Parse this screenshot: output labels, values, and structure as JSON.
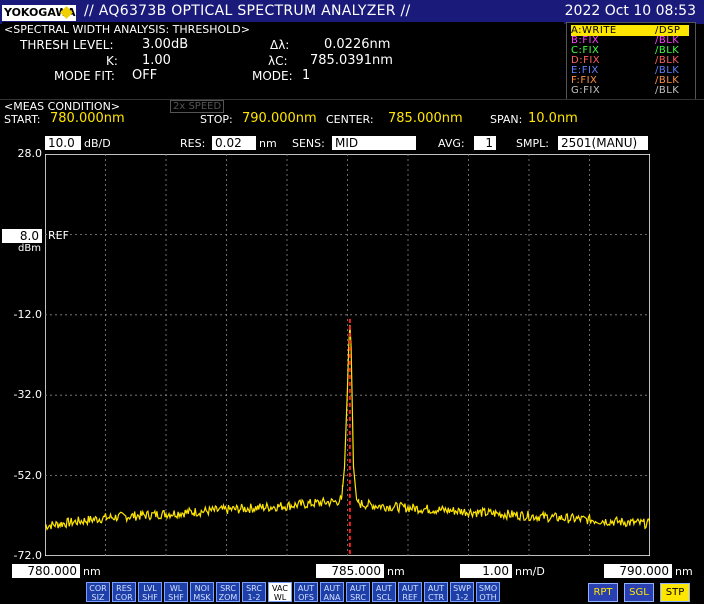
{
  "header": {
    "logo": "YOKOGAWA",
    "title": "// AQ6373B OPTICAL SPECTRUM ANALYZER //",
    "datetime": "2022 Oct 10 08:53"
  },
  "analysis": {
    "heading": "<SPECTRAL WIDTH ANALYSIS: THRESHOLD>",
    "thresh_label": "THRESH LEVEL:",
    "thresh_value": "3.00dB",
    "k_label": "K:",
    "k_value": "1.00",
    "mode_fit_label": "MODE FIT:",
    "mode_fit_value": "OFF",
    "dl_label": "Δλ:",
    "dl_value": "0.0226nm",
    "lc_label": "λC:",
    "lc_value": "785.0391nm",
    "mode_label": "MODE:",
    "mode_value": "1"
  },
  "traces": [
    {
      "name": "A:WRITE",
      "state": "/DSP",
      "color": "#ffe600"
    },
    {
      "name": "B:FIX",
      "state": "/BLK",
      "color": "#ff40ff"
    },
    {
      "name": "C:FIX",
      "state": "/BLK",
      "color": "#40ff40"
    },
    {
      "name": "D:FIX",
      "state": "/BLK",
      "color": "#ff6060"
    },
    {
      "name": "E:FIX",
      "state": "/BLK",
      "color": "#6080ff"
    },
    {
      "name": "F:FIX",
      "state": "/BLK",
      "color": "#ff9040"
    },
    {
      "name": "G:FIX",
      "state": "/BLK",
      "color": "#c0c0c0"
    }
  ],
  "meas": {
    "heading": "<MEAS CONDITION>",
    "speed": "2x SPEED",
    "start_label": "START:",
    "start_value": "780.000nm",
    "stop_label": "STOP:",
    "stop_value": "790.000nm",
    "center_label": "CENTER:",
    "center_value": "785.000nm",
    "span_label": "SPAN:",
    "span_value": "10.0nm"
  },
  "settings": {
    "scale_value": "10.0",
    "scale_unit": "dB/D",
    "res_label": "RES:",
    "res_value": "0.02",
    "res_unit": "nm",
    "sens_label": "SENS:",
    "sens_value": "MID",
    "avg_label": "AVG:",
    "avg_value": "1",
    "smpl_label": "SMPL:",
    "smpl_value": "2501(MANU)"
  },
  "ref": {
    "value": "8.0",
    "label": "REF",
    "unit": "dBm"
  },
  "bottom": {
    "start": "780.000",
    "start_unit": "nm",
    "center": "785.000",
    "center_unit": "nm",
    "xscale": "1.00",
    "xscale_unit": "nm/D",
    "stop": "790.000",
    "stop_unit": "nm"
  },
  "softkeys": [
    [
      "COR",
      "SIZ"
    ],
    [
      "RES",
      "COR"
    ],
    [
      "LVL",
      "SHF"
    ],
    [
      "WL",
      "SHF"
    ],
    [
      "NOI",
      "MSK"
    ],
    [
      "SRC",
      "ZOM"
    ],
    [
      "SRC",
      "1-2"
    ],
    [
      "VAC",
      "WL"
    ],
    [
      "AUT",
      "OFS"
    ],
    [
      "AUT",
      "ANA"
    ],
    [
      "AUT",
      "SRC"
    ],
    [
      "AUT",
      "SCL"
    ],
    [
      "AUT",
      "REF"
    ],
    [
      "AUT",
      "CTR"
    ],
    [
      "SWP",
      "1-2"
    ],
    [
      "SMO",
      "OTH"
    ]
  ],
  "action_keys": [
    "RPT",
    "SGL",
    "STP"
  ],
  "chart_data": {
    "type": "line",
    "title": "",
    "xlabel": "",
    "ylabel": "",
    "xlim": [
      780.0,
      790.0
    ],
    "ylim": [
      -72.0,
      28.0
    ],
    "yticks": [
      "28.0",
      "8.0",
      "-12.0",
      "-32.0",
      "-52.0",
      "-72.0"
    ],
    "grid": true,
    "trace_color": "#ffe600",
    "marker_color": "#ff2020",
    "marker_x": 785.039,
    "series": [
      {
        "x": [
          780.0,
          780.5,
          781.0,
          781.5,
          782.0,
          782.5,
          783.0,
          783.5,
          784.0,
          784.5,
          784.8,
          784.9,
          784.95,
          785.0,
          785.02,
          785.04,
          785.06,
          785.08,
          785.1,
          785.15,
          785.2,
          785.5,
          786.0,
          786.5,
          787.0,
          787.5,
          788.0,
          788.5,
          789.0,
          789.5,
          790.0
        ],
        "y": [
          -64.5,
          -63.5,
          -62.5,
          -62.0,
          -61.5,
          -61.0,
          -60.5,
          -60.0,
          -59.5,
          -58.8,
          -58.5,
          -58.0,
          -50.0,
          -30.0,
          -20.0,
          -14.5,
          -20.0,
          -35.0,
          -50.0,
          -58.0,
          -59.0,
          -59.5,
          -60.0,
          -60.5,
          -61.0,
          -61.5,
          -62.0,
          -62.5,
          -63.0,
          -63.5,
          -64.0
        ]
      }
    ]
  }
}
